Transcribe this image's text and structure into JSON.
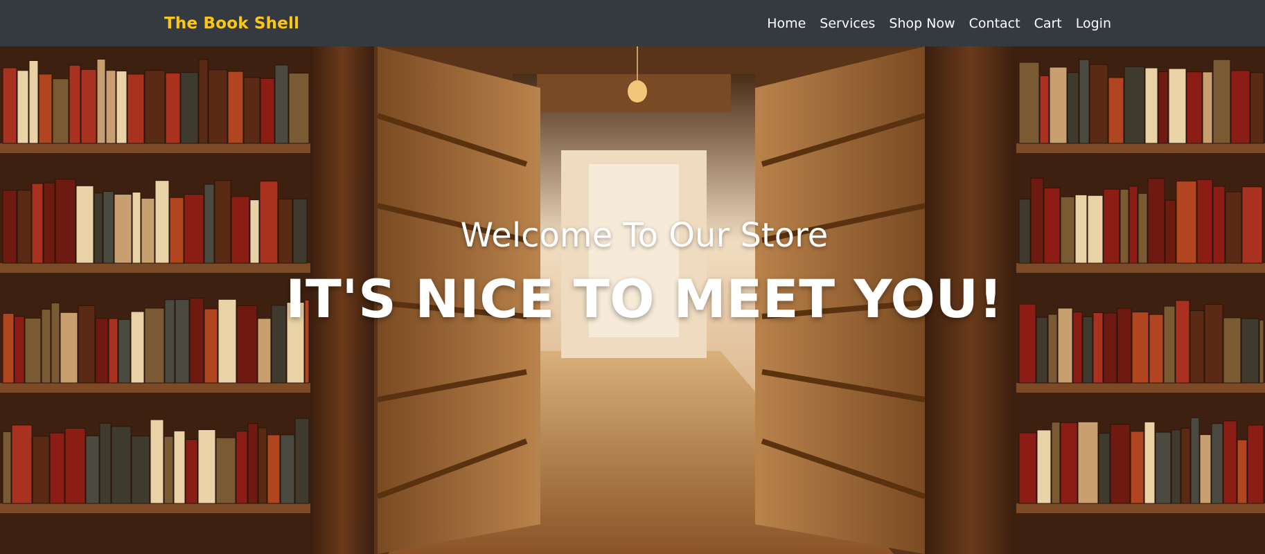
{
  "navbar": {
    "brand": "The Book Shell",
    "links": [
      "Home",
      "Services",
      "Shop Now",
      "Contact",
      "Cart",
      "Login"
    ]
  },
  "hero": {
    "subheading": "Welcome To Our Store",
    "heading": "IT'S NICE TO MEET YOU!",
    "background_image": "bookshelf-aisle-image"
  },
  "colors": {
    "navbar_bg": "#343a40",
    "brand": "#fec810",
    "nav_text": "#ffffff",
    "hero_text": "#ffffff"
  }
}
